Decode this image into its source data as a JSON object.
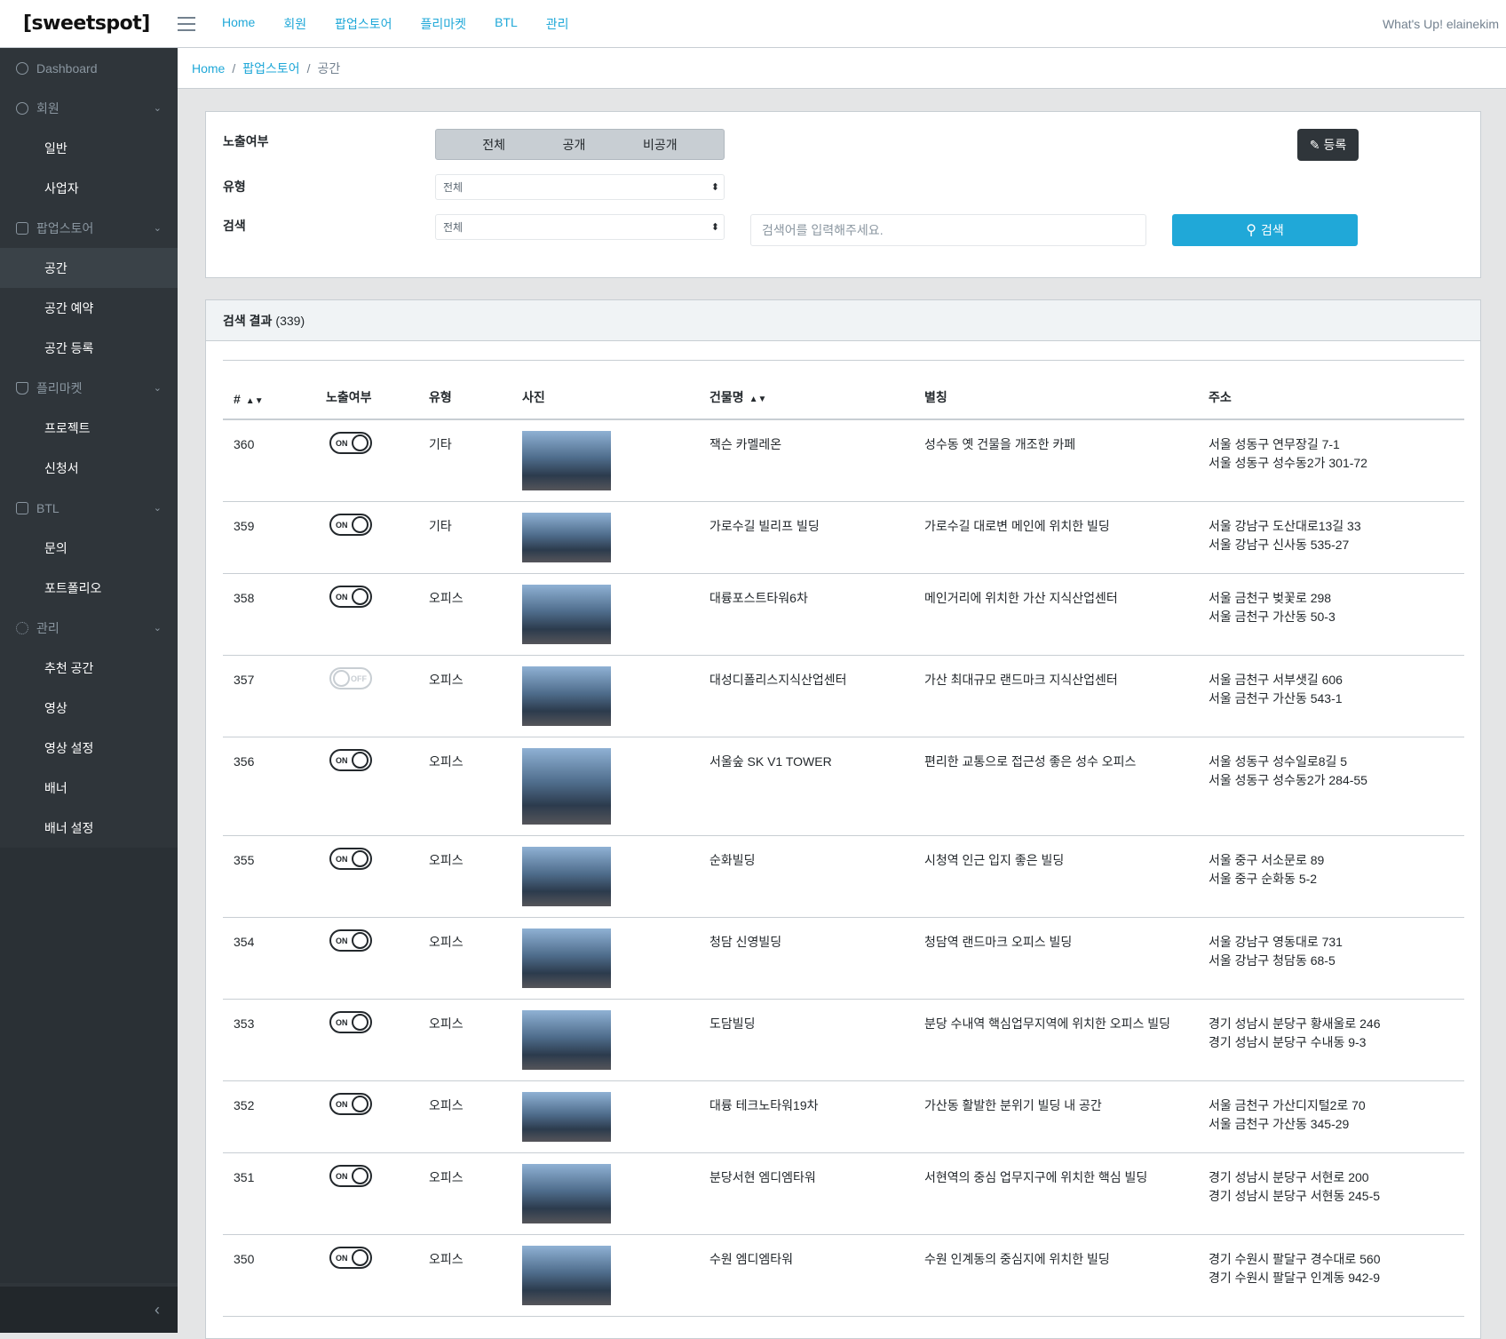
{
  "header": {
    "logo": "[sweetspot]",
    "nav": [
      "Home",
      "회원",
      "팝업스토어",
      "플리마켓",
      "BTL",
      "관리"
    ],
    "greeting": "What's Up! elainekim"
  },
  "sidebar": {
    "items": [
      {
        "label": "Dashboard",
        "type": "group"
      },
      {
        "label": "회원",
        "type": "group"
      },
      {
        "label": "일반",
        "type": "sub"
      },
      {
        "label": "사업자",
        "type": "sub"
      },
      {
        "label": "팝업스토어",
        "type": "group"
      },
      {
        "label": "공간",
        "type": "sub"
      },
      {
        "label": "공간 예약",
        "type": "sub"
      },
      {
        "label": "공간 등록",
        "type": "sub"
      },
      {
        "label": "플리마켓",
        "type": "group"
      },
      {
        "label": "프로젝트",
        "type": "sub"
      },
      {
        "label": "신청서",
        "type": "sub"
      },
      {
        "label": "BTL",
        "type": "group"
      },
      {
        "label": "문의",
        "type": "sub"
      },
      {
        "label": "포트폴리오",
        "type": "sub"
      },
      {
        "label": "관리",
        "type": "group"
      },
      {
        "label": "추천 공간",
        "type": "sub"
      },
      {
        "label": "영상",
        "type": "sub"
      },
      {
        "label": "영상 설정",
        "type": "sub"
      },
      {
        "label": "배너",
        "type": "sub"
      },
      {
        "label": "배너 설정",
        "type": "sub"
      }
    ],
    "collapse": "‹"
  },
  "breadcrumb": {
    "items": [
      "Home",
      "팝업스토어"
    ],
    "current": "공간"
  },
  "filter": {
    "exposure_label": "노출여부",
    "exposure_options": [
      "전체",
      "공개",
      "비공개"
    ],
    "type_label": "유형",
    "type_value": "전체",
    "search_label": "검색",
    "search_field_value": "전체",
    "search_placeholder": "검색어를 입력해주세요.",
    "register_button": "등록",
    "search_button": "검색"
  },
  "results": {
    "title": "검색 결과",
    "count": "(339)",
    "columns": [
      "#",
      "노출여부",
      "유형",
      "사진",
      "건물명",
      "별칭",
      "주소"
    ],
    "rows": [
      {
        "no": "360",
        "status": "ON",
        "type": "기타",
        "building": "잭슨 카멜레온",
        "nickname": "성수동 옛 건물을 개조한 카페",
        "addr1": "서울 성동구 연무장길 7-1",
        "addr2": "서울 성동구 성수동2가 301-72"
      },
      {
        "no": "359",
        "status": "ON",
        "type": "기타",
        "building": "가로수길 빌리프 빌딩",
        "nickname": "가로수길 대로변 메인에 위치한 빌딩",
        "addr1": "서울 강남구 도산대로13길 33",
        "addr2": "서울 강남구 신사동 535-27"
      },
      {
        "no": "358",
        "status": "ON",
        "type": "오피스",
        "building": "대륭포스트타워6차",
        "nickname": "메인거리에 위치한 가산 지식산업센터",
        "addr1": "서울 금천구 벚꽃로 298",
        "addr2": "서울 금천구 가산동 50-3"
      },
      {
        "no": "357",
        "status": "OFF",
        "type": "오피스",
        "building": "대성디폴리스지식산업센터",
        "nickname": "가산 최대규모 랜드마크 지식산업센터",
        "addr1": "서울 금천구 서부샛길 606",
        "addr2": "서울 금천구 가산동 543-1"
      },
      {
        "no": "356",
        "status": "ON",
        "type": "오피스",
        "building": "서울숲 SK V1 TOWER",
        "nickname": "편리한 교통으로 접근성 좋은 성수 오피스",
        "addr1": "서울 성동구 성수일로8길 5",
        "addr2": "서울 성동구 성수동2가 284-55"
      },
      {
        "no": "355",
        "status": "ON",
        "type": "오피스",
        "building": "순화빌딩",
        "nickname": "시청역 인근 입지 좋은 빌딩",
        "addr1": "서울 중구 서소문로 89",
        "addr2": "서울 중구 순화동 5-2"
      },
      {
        "no": "354",
        "status": "ON",
        "type": "오피스",
        "building": "청담 신영빌딩",
        "nickname": "청담역 랜드마크 오피스 빌딩",
        "addr1": "서울 강남구 영동대로 731",
        "addr2": "서울 강남구 청담동 68-5"
      },
      {
        "no": "353",
        "status": "ON",
        "type": "오피스",
        "building": "도담빌딩",
        "nickname": "분당 수내역 핵심업무지역에 위치한 오피스 빌딩",
        "addr1": "경기 성남시 분당구 황새울로 246",
        "addr2": "경기 성남시 분당구 수내동 9-3"
      },
      {
        "no": "352",
        "status": "ON",
        "type": "오피스",
        "building": "대륭 테크노타워19차",
        "nickname": "가산동 활발한 분위기 빌딩 내 공간",
        "addr1": "서울 금천구 가산디지털2로 70",
        "addr2": "서울 금천구 가산동 345-29"
      },
      {
        "no": "351",
        "status": "ON",
        "type": "오피스",
        "building": "분당서현 엠디엠타워",
        "nickname": "서현역의 중심 업무지구에 위치한 핵심 빌딩",
        "addr1": "경기 성남시 분당구 서현로 200",
        "addr2": "경기 성남시 분당구 서현동 245-5"
      },
      {
        "no": "350",
        "status": "ON",
        "type": "오피스",
        "building": "수원 엠디엠타워",
        "nickname": "수원 인계동의 중심지에 위치한 빌딩",
        "addr1": "경기 수원시 팔달구 경수대로 560",
        "addr2": "경기 수원시 팔달구 인계동 942-9"
      }
    ]
  }
}
